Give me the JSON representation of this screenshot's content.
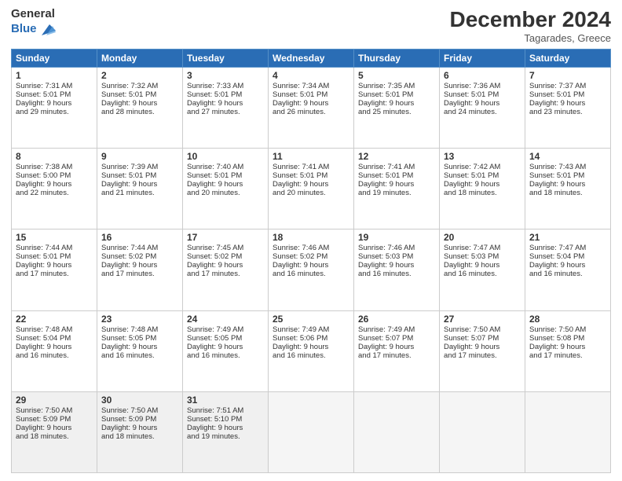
{
  "logo": {
    "general": "General",
    "blue": "Blue"
  },
  "header": {
    "month": "December 2024",
    "location": "Tagarades, Greece"
  },
  "days_of_week": [
    "Sunday",
    "Monday",
    "Tuesday",
    "Wednesday",
    "Thursday",
    "Friday",
    "Saturday"
  ],
  "weeks": [
    [
      {
        "day": "1",
        "lines": [
          "Sunrise: 7:31 AM",
          "Sunset: 5:01 PM",
          "Daylight: 9 hours",
          "and 29 minutes."
        ]
      },
      {
        "day": "2",
        "lines": [
          "Sunrise: 7:32 AM",
          "Sunset: 5:01 PM",
          "Daylight: 9 hours",
          "and 28 minutes."
        ]
      },
      {
        "day": "3",
        "lines": [
          "Sunrise: 7:33 AM",
          "Sunset: 5:01 PM",
          "Daylight: 9 hours",
          "and 27 minutes."
        ]
      },
      {
        "day": "4",
        "lines": [
          "Sunrise: 7:34 AM",
          "Sunset: 5:01 PM",
          "Daylight: 9 hours",
          "and 26 minutes."
        ]
      },
      {
        "day": "5",
        "lines": [
          "Sunrise: 7:35 AM",
          "Sunset: 5:01 PM",
          "Daylight: 9 hours",
          "and 25 minutes."
        ]
      },
      {
        "day": "6",
        "lines": [
          "Sunrise: 7:36 AM",
          "Sunset: 5:01 PM",
          "Daylight: 9 hours",
          "and 24 minutes."
        ]
      },
      {
        "day": "7",
        "lines": [
          "Sunrise: 7:37 AM",
          "Sunset: 5:01 PM",
          "Daylight: 9 hours",
          "and 23 minutes."
        ]
      }
    ],
    [
      {
        "day": "8",
        "lines": [
          "Sunrise: 7:38 AM",
          "Sunset: 5:00 PM",
          "Daylight: 9 hours",
          "and 22 minutes."
        ]
      },
      {
        "day": "9",
        "lines": [
          "Sunrise: 7:39 AM",
          "Sunset: 5:01 PM",
          "Daylight: 9 hours",
          "and 21 minutes."
        ]
      },
      {
        "day": "10",
        "lines": [
          "Sunrise: 7:40 AM",
          "Sunset: 5:01 PM",
          "Daylight: 9 hours",
          "and 20 minutes."
        ]
      },
      {
        "day": "11",
        "lines": [
          "Sunrise: 7:41 AM",
          "Sunset: 5:01 PM",
          "Daylight: 9 hours",
          "and 20 minutes."
        ]
      },
      {
        "day": "12",
        "lines": [
          "Sunrise: 7:41 AM",
          "Sunset: 5:01 PM",
          "Daylight: 9 hours",
          "and 19 minutes."
        ]
      },
      {
        "day": "13",
        "lines": [
          "Sunrise: 7:42 AM",
          "Sunset: 5:01 PM",
          "Daylight: 9 hours",
          "and 18 minutes."
        ]
      },
      {
        "day": "14",
        "lines": [
          "Sunrise: 7:43 AM",
          "Sunset: 5:01 PM",
          "Daylight: 9 hours",
          "and 18 minutes."
        ]
      }
    ],
    [
      {
        "day": "15",
        "lines": [
          "Sunrise: 7:44 AM",
          "Sunset: 5:01 PM",
          "Daylight: 9 hours",
          "and 17 minutes."
        ]
      },
      {
        "day": "16",
        "lines": [
          "Sunrise: 7:44 AM",
          "Sunset: 5:02 PM",
          "Daylight: 9 hours",
          "and 17 minutes."
        ]
      },
      {
        "day": "17",
        "lines": [
          "Sunrise: 7:45 AM",
          "Sunset: 5:02 PM",
          "Daylight: 9 hours",
          "and 17 minutes."
        ]
      },
      {
        "day": "18",
        "lines": [
          "Sunrise: 7:46 AM",
          "Sunset: 5:02 PM",
          "Daylight: 9 hours",
          "and 16 minutes."
        ]
      },
      {
        "day": "19",
        "lines": [
          "Sunrise: 7:46 AM",
          "Sunset: 5:03 PM",
          "Daylight: 9 hours",
          "and 16 minutes."
        ]
      },
      {
        "day": "20",
        "lines": [
          "Sunrise: 7:47 AM",
          "Sunset: 5:03 PM",
          "Daylight: 9 hours",
          "and 16 minutes."
        ]
      },
      {
        "day": "21",
        "lines": [
          "Sunrise: 7:47 AM",
          "Sunset: 5:04 PM",
          "Daylight: 9 hours",
          "and 16 minutes."
        ]
      }
    ],
    [
      {
        "day": "22",
        "lines": [
          "Sunrise: 7:48 AM",
          "Sunset: 5:04 PM",
          "Daylight: 9 hours",
          "and 16 minutes."
        ]
      },
      {
        "day": "23",
        "lines": [
          "Sunrise: 7:48 AM",
          "Sunset: 5:05 PM",
          "Daylight: 9 hours",
          "and 16 minutes."
        ]
      },
      {
        "day": "24",
        "lines": [
          "Sunrise: 7:49 AM",
          "Sunset: 5:05 PM",
          "Daylight: 9 hours",
          "and 16 minutes."
        ]
      },
      {
        "day": "25",
        "lines": [
          "Sunrise: 7:49 AM",
          "Sunset: 5:06 PM",
          "Daylight: 9 hours",
          "and 16 minutes."
        ]
      },
      {
        "day": "26",
        "lines": [
          "Sunrise: 7:49 AM",
          "Sunset: 5:07 PM",
          "Daylight: 9 hours",
          "and 17 minutes."
        ]
      },
      {
        "day": "27",
        "lines": [
          "Sunrise: 7:50 AM",
          "Sunset: 5:07 PM",
          "Daylight: 9 hours",
          "and 17 minutes."
        ]
      },
      {
        "day": "28",
        "lines": [
          "Sunrise: 7:50 AM",
          "Sunset: 5:08 PM",
          "Daylight: 9 hours",
          "and 17 minutes."
        ]
      }
    ],
    [
      {
        "day": "29",
        "lines": [
          "Sunrise: 7:50 AM",
          "Sunset: 5:09 PM",
          "Daylight: 9 hours",
          "and 18 minutes."
        ]
      },
      {
        "day": "30",
        "lines": [
          "Sunrise: 7:50 AM",
          "Sunset: 5:09 PM",
          "Daylight: 9 hours",
          "and 18 minutes."
        ]
      },
      {
        "day": "31",
        "lines": [
          "Sunrise: 7:51 AM",
          "Sunset: 5:10 PM",
          "Daylight: 9 hours",
          "and 19 minutes."
        ]
      },
      {
        "day": "",
        "lines": []
      },
      {
        "day": "",
        "lines": []
      },
      {
        "day": "",
        "lines": []
      },
      {
        "day": "",
        "lines": []
      }
    ]
  ]
}
